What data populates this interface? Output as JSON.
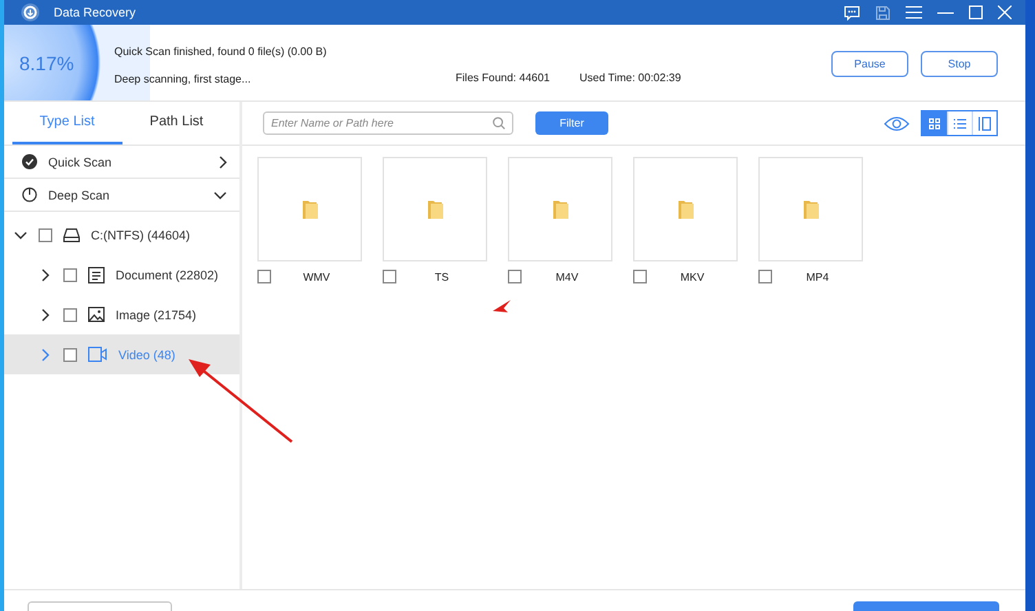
{
  "window": {
    "title": "Data Recovery"
  },
  "scan": {
    "percent": "8.17%",
    "status_lines": [
      "Quick Scan finished, found 0 file(s) (0.00  B)",
      "Deep scanning, first stage..."
    ],
    "files_found": "Files Found: 44601",
    "used_time": "Used Time: 00:02:39",
    "buttons": [
      "Pause",
      "Stop"
    ]
  },
  "tabs": [
    {
      "label": "Type List",
      "selected": true
    },
    {
      "label": "Path List",
      "selected": false
    }
  ],
  "scans": [
    {
      "label": "Quick Scan",
      "kind": "done",
      "expanded": false
    },
    {
      "label": "Deep Scan",
      "kind": "running",
      "expanded": true
    }
  ],
  "tree": [
    {
      "label": "C:(NTFS) (44604)",
      "kind": "drive",
      "checked": false,
      "expanded": true,
      "selected": false,
      "children": [
        {
          "label": "Document (22802)",
          "kind": "document",
          "checked": false,
          "expanded": false,
          "selected": false
        },
        {
          "label": "Image (21754)",
          "kind": "image",
          "checked": false,
          "expanded": false,
          "selected": false
        },
        {
          "label": "Video (48)",
          "kind": "video",
          "checked": false,
          "expanded": false,
          "selected": true
        }
      ]
    }
  ],
  "search": {
    "placeholder": "Enter Name or Path here"
  },
  "filter_button": "Filter",
  "view_modes": [
    {
      "kind": "grid",
      "selected": true
    },
    {
      "kind": "list",
      "selected": false
    },
    {
      "kind": "preview",
      "selected": false
    }
  ],
  "files": [
    {
      "name": "WMV",
      "checked": false
    },
    {
      "name": "TS",
      "checked": false
    },
    {
      "name": "M4V",
      "checked": false
    },
    {
      "name": "MKV",
      "checked": false
    },
    {
      "name": "MP4",
      "checked": false
    }
  ]
}
